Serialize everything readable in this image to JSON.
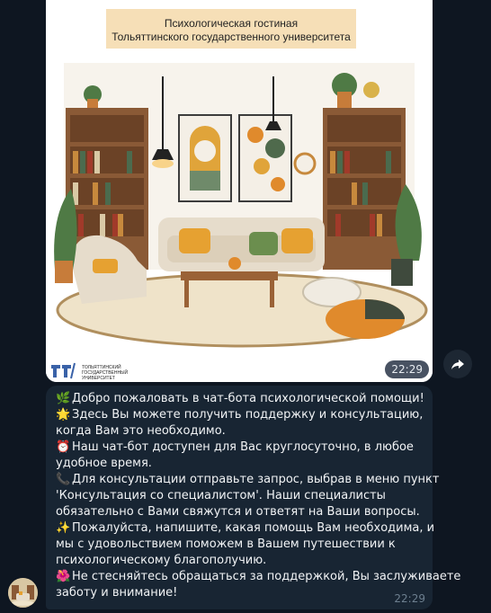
{
  "image_message": {
    "banner_line1": "Психологическая гостиная",
    "banner_line2": "Тольяттинского государственного университета",
    "logo_line1": "ТОЛЬЯТТИНСКИЙ",
    "logo_line2": "ГОСУДАРСТВЕННЫЙ",
    "logo_line3": "УНИВЕРСИТЕТ",
    "time": "22:29"
  },
  "text_message": {
    "lines": [
      {
        "emoji": "🌿",
        "text": "Добро пожаловать в чат-бота психологической помощи!"
      },
      {
        "emoji": "🌟",
        "text": "Здесь Вы можете получить поддержку и консультацию,"
      },
      {
        "emoji": "",
        "text": "когда Вам это необходимо."
      },
      {
        "emoji": "⏰",
        "text": "Наш чат-бот доступен для Вас круглосуточно, в любое"
      },
      {
        "emoji": "",
        "text": "удобное время."
      },
      {
        "emoji": "📞",
        "text": "Для консультации отправьте запрос, выбрав в меню пункт"
      },
      {
        "emoji": "",
        "text": "'Консультация со специалистом'. Наши специалисты"
      },
      {
        "emoji": "",
        "text": "обязательно с Вами свяжутся и ответят на Ваши вопросы."
      },
      {
        "emoji": "✨",
        "text": "Пожалуйста, напишите, какая помощь Вам необходима, и"
      },
      {
        "emoji": "",
        "text": "мы с удовольствием поможем в Вашем путешествии к"
      },
      {
        "emoji": "",
        "text": "психологическому благополучию."
      },
      {
        "emoji": "🌺",
        "text": "Не стесняйтесь обращаться за поддержкой, Вы заслуживаете"
      },
      {
        "emoji": "",
        "text": "заботу и внимание!"
      }
    ],
    "time": "22:29"
  },
  "icons": {
    "share": "share-arrow-icon",
    "avatar": "bot-avatar"
  },
  "colors": {
    "background": "#0e1621",
    "bubble": "#182533",
    "time_pill": "#283446",
    "accent_orange": "#e8a33a"
  }
}
